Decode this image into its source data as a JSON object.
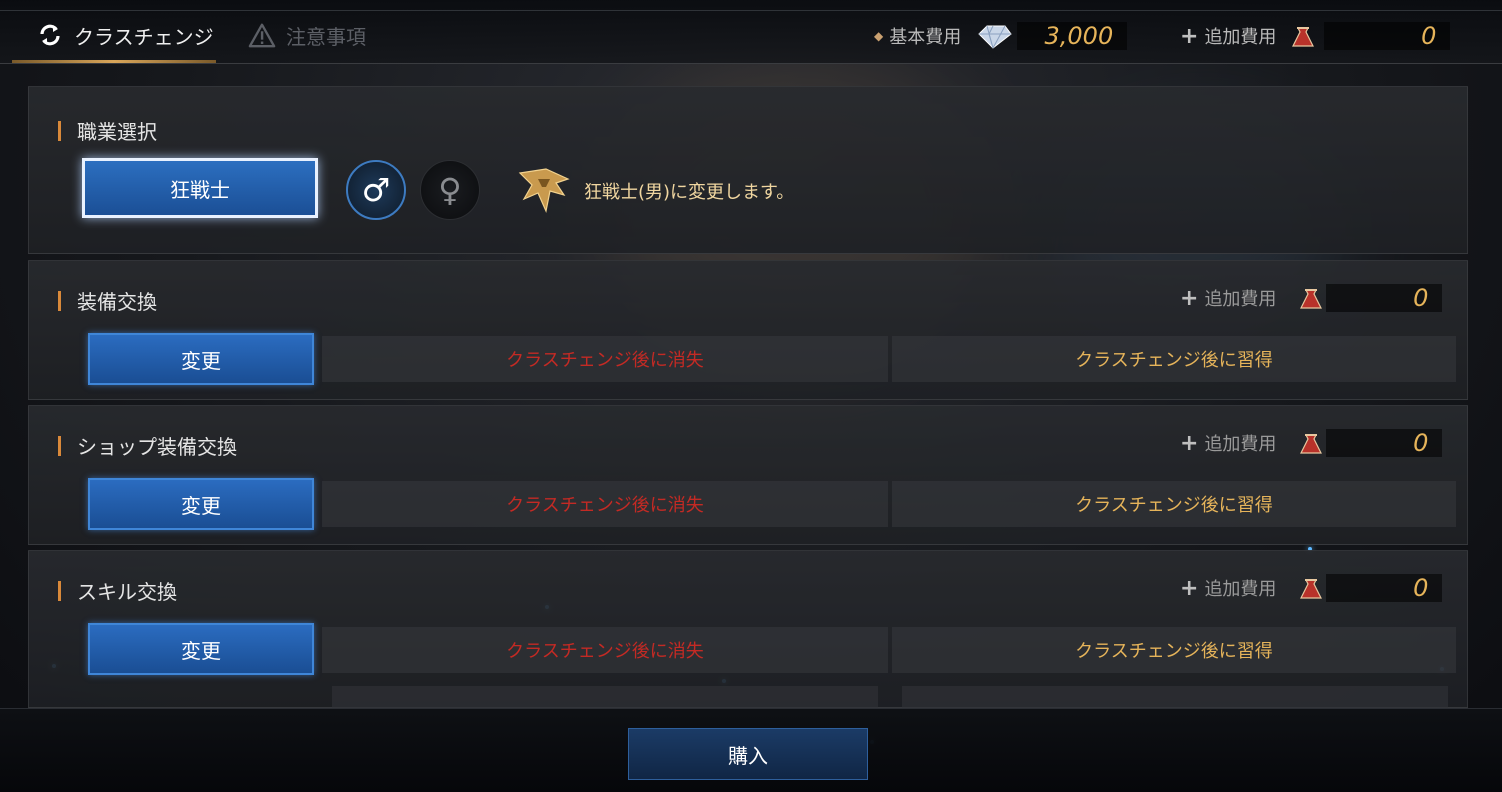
{
  "tabs": {
    "class_change": "クラスチェンジ",
    "notes": "注意事項"
  },
  "header_costs": {
    "base_label": "基本費用",
    "base_value": "3,000",
    "extra_label": "追加費用",
    "extra_value": "0"
  },
  "job_section": {
    "title": "職業選択",
    "selected_job": "狂戦士",
    "male_symbol": "♂",
    "female_symbol": "♀",
    "message": "狂戦士(男)に変更します。"
  },
  "sections": [
    {
      "title": "装備交換",
      "extra_label": "追加費用",
      "extra_value": "0",
      "change_label": "変更",
      "lost_text": "クラスチェンジ後に消失",
      "gain_text": "クラスチェンジ後に習得"
    },
    {
      "title": "ショップ装備交換",
      "extra_label": "追加費用",
      "extra_value": "0",
      "change_label": "変更",
      "lost_text": "クラスチェンジ後に消失",
      "gain_text": "クラスチェンジ後に習得"
    },
    {
      "title": "スキル交換",
      "extra_label": "追加費用",
      "extra_value": "0",
      "change_label": "変更",
      "lost_text": "クラスチェンジ後に消失",
      "gain_text": "クラスチェンジ後に習得"
    }
  ],
  "buy_label": "購入",
  "icons": {
    "refresh": "refresh-icon",
    "warning": "warning-icon",
    "diamond": "diamond-icon",
    "pouch": "pouch-icon",
    "class_emblem": "berserker-emblem-icon"
  },
  "colors": {
    "accent_gold": "#e6b45a",
    "lost_red": "#c42a24",
    "button_blue": "#2b6cc0"
  }
}
